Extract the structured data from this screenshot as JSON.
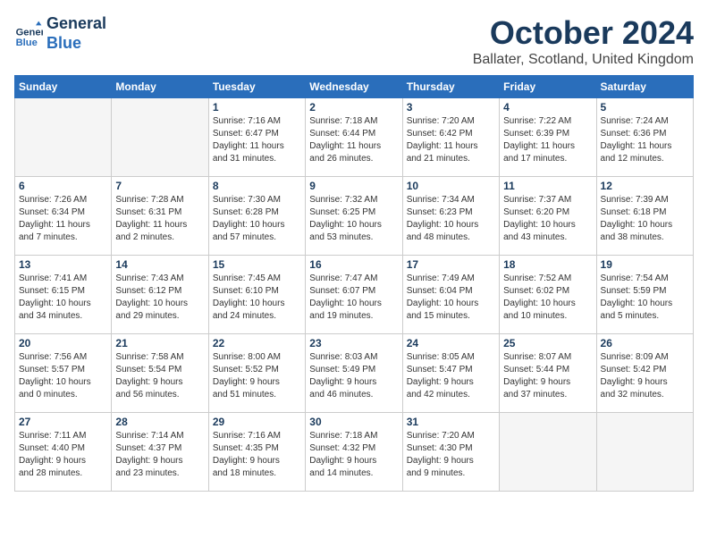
{
  "header": {
    "logo_line1": "General",
    "logo_line2": "Blue",
    "month": "October 2024",
    "location": "Ballater, Scotland, United Kingdom"
  },
  "days_of_week": [
    "Sunday",
    "Monday",
    "Tuesday",
    "Wednesday",
    "Thursday",
    "Friday",
    "Saturday"
  ],
  "weeks": [
    [
      {
        "day": "",
        "info": ""
      },
      {
        "day": "",
        "info": ""
      },
      {
        "day": "1",
        "info": "Sunrise: 7:16 AM\nSunset: 6:47 PM\nDaylight: 11 hours\nand 31 minutes."
      },
      {
        "day": "2",
        "info": "Sunrise: 7:18 AM\nSunset: 6:44 PM\nDaylight: 11 hours\nand 26 minutes."
      },
      {
        "day": "3",
        "info": "Sunrise: 7:20 AM\nSunset: 6:42 PM\nDaylight: 11 hours\nand 21 minutes."
      },
      {
        "day": "4",
        "info": "Sunrise: 7:22 AM\nSunset: 6:39 PM\nDaylight: 11 hours\nand 17 minutes."
      },
      {
        "day": "5",
        "info": "Sunrise: 7:24 AM\nSunset: 6:36 PM\nDaylight: 11 hours\nand 12 minutes."
      }
    ],
    [
      {
        "day": "6",
        "info": "Sunrise: 7:26 AM\nSunset: 6:34 PM\nDaylight: 11 hours\nand 7 minutes."
      },
      {
        "day": "7",
        "info": "Sunrise: 7:28 AM\nSunset: 6:31 PM\nDaylight: 11 hours\nand 2 minutes."
      },
      {
        "day": "8",
        "info": "Sunrise: 7:30 AM\nSunset: 6:28 PM\nDaylight: 10 hours\nand 57 minutes."
      },
      {
        "day": "9",
        "info": "Sunrise: 7:32 AM\nSunset: 6:25 PM\nDaylight: 10 hours\nand 53 minutes."
      },
      {
        "day": "10",
        "info": "Sunrise: 7:34 AM\nSunset: 6:23 PM\nDaylight: 10 hours\nand 48 minutes."
      },
      {
        "day": "11",
        "info": "Sunrise: 7:37 AM\nSunset: 6:20 PM\nDaylight: 10 hours\nand 43 minutes."
      },
      {
        "day": "12",
        "info": "Sunrise: 7:39 AM\nSunset: 6:18 PM\nDaylight: 10 hours\nand 38 minutes."
      }
    ],
    [
      {
        "day": "13",
        "info": "Sunrise: 7:41 AM\nSunset: 6:15 PM\nDaylight: 10 hours\nand 34 minutes."
      },
      {
        "day": "14",
        "info": "Sunrise: 7:43 AM\nSunset: 6:12 PM\nDaylight: 10 hours\nand 29 minutes."
      },
      {
        "day": "15",
        "info": "Sunrise: 7:45 AM\nSunset: 6:10 PM\nDaylight: 10 hours\nand 24 minutes."
      },
      {
        "day": "16",
        "info": "Sunrise: 7:47 AM\nSunset: 6:07 PM\nDaylight: 10 hours\nand 19 minutes."
      },
      {
        "day": "17",
        "info": "Sunrise: 7:49 AM\nSunset: 6:04 PM\nDaylight: 10 hours\nand 15 minutes."
      },
      {
        "day": "18",
        "info": "Sunrise: 7:52 AM\nSunset: 6:02 PM\nDaylight: 10 hours\nand 10 minutes."
      },
      {
        "day": "19",
        "info": "Sunrise: 7:54 AM\nSunset: 5:59 PM\nDaylight: 10 hours\nand 5 minutes."
      }
    ],
    [
      {
        "day": "20",
        "info": "Sunrise: 7:56 AM\nSunset: 5:57 PM\nDaylight: 10 hours\nand 0 minutes."
      },
      {
        "day": "21",
        "info": "Sunrise: 7:58 AM\nSunset: 5:54 PM\nDaylight: 9 hours\nand 56 minutes."
      },
      {
        "day": "22",
        "info": "Sunrise: 8:00 AM\nSunset: 5:52 PM\nDaylight: 9 hours\nand 51 minutes."
      },
      {
        "day": "23",
        "info": "Sunrise: 8:03 AM\nSunset: 5:49 PM\nDaylight: 9 hours\nand 46 minutes."
      },
      {
        "day": "24",
        "info": "Sunrise: 8:05 AM\nSunset: 5:47 PM\nDaylight: 9 hours\nand 42 minutes."
      },
      {
        "day": "25",
        "info": "Sunrise: 8:07 AM\nSunset: 5:44 PM\nDaylight: 9 hours\nand 37 minutes."
      },
      {
        "day": "26",
        "info": "Sunrise: 8:09 AM\nSunset: 5:42 PM\nDaylight: 9 hours\nand 32 minutes."
      }
    ],
    [
      {
        "day": "27",
        "info": "Sunrise: 7:11 AM\nSunset: 4:40 PM\nDaylight: 9 hours\nand 28 minutes."
      },
      {
        "day": "28",
        "info": "Sunrise: 7:14 AM\nSunset: 4:37 PM\nDaylight: 9 hours\nand 23 minutes."
      },
      {
        "day": "29",
        "info": "Sunrise: 7:16 AM\nSunset: 4:35 PM\nDaylight: 9 hours\nand 18 minutes."
      },
      {
        "day": "30",
        "info": "Sunrise: 7:18 AM\nSunset: 4:32 PM\nDaylight: 9 hours\nand 14 minutes."
      },
      {
        "day": "31",
        "info": "Sunrise: 7:20 AM\nSunset: 4:30 PM\nDaylight: 9 hours\nand 9 minutes."
      },
      {
        "day": "",
        "info": ""
      },
      {
        "day": "",
        "info": ""
      }
    ]
  ]
}
